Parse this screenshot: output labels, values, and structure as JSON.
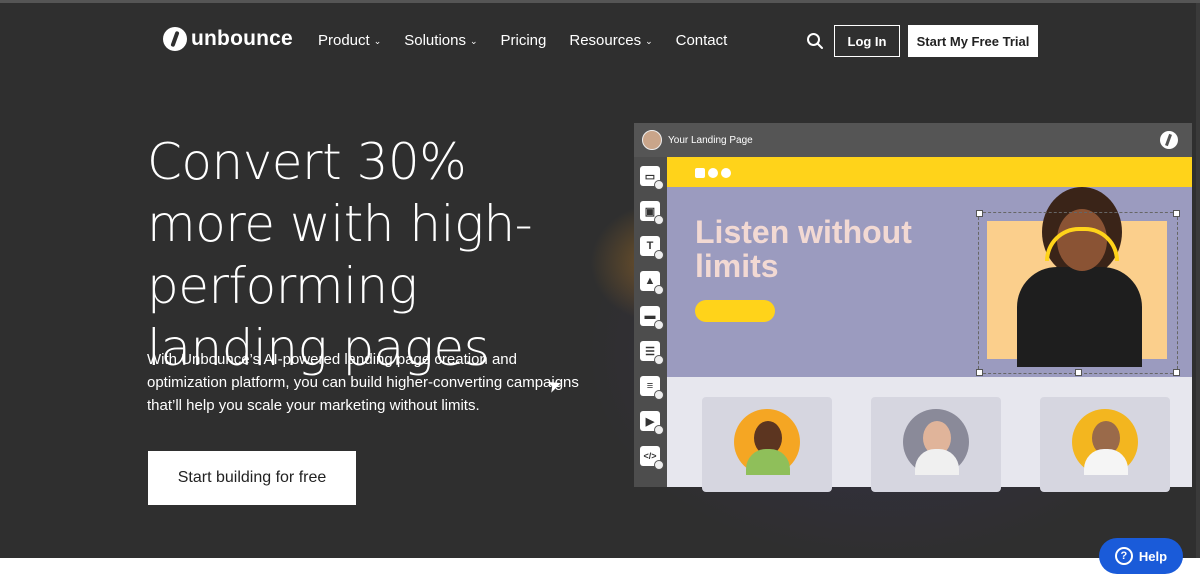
{
  "brand": {
    "name": "unbounce"
  },
  "nav": {
    "items": [
      {
        "label": "Product",
        "dropdown": true
      },
      {
        "label": "Solutions",
        "dropdown": true
      },
      {
        "label": "Pricing",
        "dropdown": false
      },
      {
        "label": "Resources",
        "dropdown": true
      },
      {
        "label": "Contact",
        "dropdown": false
      }
    ],
    "login_label": "Log In",
    "trial_label": "Start My Free Trial"
  },
  "hero": {
    "headline": "Convert 30% more with high-performing landing pages",
    "subtext": "With Unbounce’s AI-powered landing page creation and optimization platform, you can build higher-converting campaigns that’ll help you scale your marketing without limits.",
    "cta_label": "Start building for free"
  },
  "mockup": {
    "title": "Your Landing Page",
    "headline": "Listen without limits",
    "tools": [
      "section-icon",
      "box-icon",
      "text-icon",
      "image-icon",
      "button-icon",
      "form-icon",
      "list-icon",
      "video-icon",
      "code-icon"
    ]
  },
  "help": {
    "label": "Help"
  },
  "colors": {
    "hero_bg": "#2f2f2f",
    "accent_yellow": "#ffd31a",
    "help_blue": "#1a5bd9",
    "canvas_purple": "#9b9bbf"
  }
}
